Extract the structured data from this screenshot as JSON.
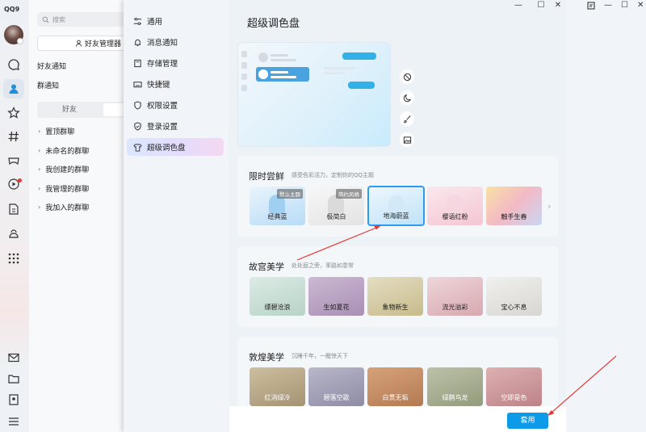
{
  "app": {
    "logo": "QQ9"
  },
  "rail": {
    "icons": [
      "chat-icon",
      "contacts-icon",
      "star-icon",
      "hash-icon",
      "game-icon",
      "video-icon",
      "file-icon",
      "guild-icon",
      "apps-grid-icon",
      "mail-icon",
      "folder-icon",
      "bookmark-icon",
      "menu-icon"
    ]
  },
  "contacts": {
    "search_placeholder": "搜索",
    "friend_manager": "好友管理器",
    "friend_notice": "好友通知",
    "group_notice": "群通知",
    "tab_friends": "好友",
    "groups": [
      "置顶群聊",
      "未命名的群聊",
      "我创建的群聊",
      "我管理的群聊",
      "我加入的群聊"
    ]
  },
  "settings": {
    "window_controls": [
      "—",
      "☐",
      "✕"
    ],
    "nav": [
      "通用",
      "消息通知",
      "存储管理",
      "快捷键",
      "权限设置",
      "登录设置",
      "超级调色盘"
    ],
    "page_title": "超级调色盘",
    "sections": [
      {
        "title": "限时尝鲜",
        "subtitle": "感受色彩活力，定制你的QQ主题",
        "tiles": [
          {
            "label": "经典蓝",
            "tag": "默认主题",
            "color": "#d6ebfb"
          },
          {
            "label": "极简白",
            "tag": "简约风格",
            "color": "#f2f2f2"
          },
          {
            "label": "地海蔚蓝",
            "tag": "",
            "color": "#cfe9fa"
          },
          {
            "label": "樱语红粉",
            "tag": "",
            "color": "#f7dce6"
          },
          {
            "label": "触手生春",
            "tag": "",
            "color": "#f4d2c8"
          }
        ]
      },
      {
        "title": "故宫美学",
        "subtitle": "处处庭之旁，率路如意常",
        "tiles": [
          {
            "label": "缥碧沧浪",
            "color": "#cfe3da"
          },
          {
            "label": "生如夏花",
            "color": "#c7b4cc"
          },
          {
            "label": "象物新生",
            "color": "#d9d2b3"
          },
          {
            "label": "流光溢彩",
            "color": "#e5c9cd"
          },
          {
            "label": "宝心不息",
            "color": "#e4e4e2"
          }
        ]
      },
      {
        "title": "敦煌美学",
        "subtitle": "沉睡千年，一醒惊天下",
        "tiles": [
          {
            "label": "红消绿冷",
            "color": "#b9a98c"
          },
          {
            "label": "碧落空歌",
            "color": "#a6a5b8"
          },
          {
            "label": "白贯无垢",
            "color": "#c49470"
          },
          {
            "label": "绿鹊鸟龙",
            "color": "#a9b096"
          },
          {
            "label": "空即是色",
            "color": "#cfa0a3"
          }
        ]
      }
    ],
    "apply_label": "套用",
    "theme_tools": [
      "block-icon",
      "moon-icon",
      "brush-icon",
      "image-icon"
    ]
  },
  "colors": {
    "accent": "#0d9ae8",
    "arrow": "#e53935",
    "selected_border": "#2d9cf0"
  }
}
